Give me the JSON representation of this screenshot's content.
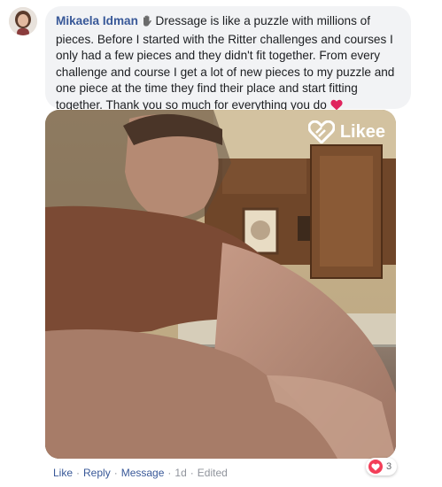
{
  "comment": {
    "author": "Mikaela Idman",
    "text": " Dressage is like a puzzle with millions of pieces. Before I started with the Ritter challenges and courses I only had a few pieces and they didn't fit together. From every challenge and course I get a lot of new pieces to my puzzle and one piece at the time they find their place and start fitting together. Thank you so much for everything you do "
  },
  "media": {
    "watermark": "Likee"
  },
  "actions": {
    "like": "Like",
    "reply": "Reply",
    "message": "Message",
    "time": "1d",
    "edited": "Edited",
    "separator": "·"
  },
  "reactions": {
    "count": "3",
    "icon": "heart-reaction-icon",
    "color": "#f33e58"
  },
  "colors": {
    "link": "#385898",
    "bubble": "#f2f3f5",
    "muted": "#90949c"
  }
}
